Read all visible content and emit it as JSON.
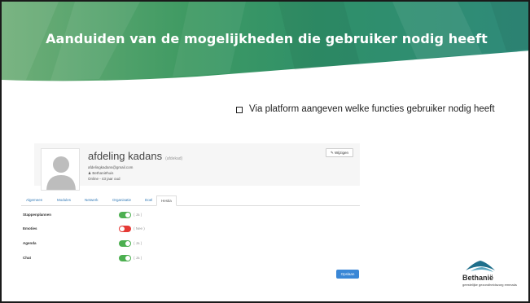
{
  "slide": {
    "title": "Aanduiden van de mogelijkheden die gebruiker nodig heeft",
    "bullet": "Via platform aangeven welke functies gebruiker nodig heeft"
  },
  "profile": {
    "name": "afdeling kadans",
    "name_tag": "(afdekad)",
    "email": "afdelingkadans@gmail.com",
    "organization": "Bethaniëhuis",
    "last_online": "Online - 43 jaar oud",
    "edit_label": "✎ Wijzigen"
  },
  "tabs": [
    {
      "label": "Algemeen"
    },
    {
      "label": "Modules"
    },
    {
      "label": "Netwerk"
    },
    {
      "label": "Organisatie"
    },
    {
      "label": "Doel"
    },
    {
      "label": "Hestia",
      "active": true
    }
  ],
  "permissions": [
    {
      "label": "Stappenplannen",
      "state": "( Ja )",
      "enabled": true
    },
    {
      "label": "Emoties",
      "state": "( Nee )",
      "enabled": false
    },
    {
      "label": "Agenda",
      "state": "( Ja )",
      "enabled": true
    },
    {
      "label": "Chat",
      "state": "( Ja )",
      "enabled": true
    }
  ],
  "save_label": "Opslaan",
  "logo": {
    "name": "Bethanië",
    "tagline": "geestelijke gezondheidszorg emmaüs"
  },
  "colors": {
    "header_green": "#3a9a5c",
    "toggle_on": "#4caf50",
    "toggle_off": "#e53935",
    "save_blue": "#3a87d6"
  }
}
